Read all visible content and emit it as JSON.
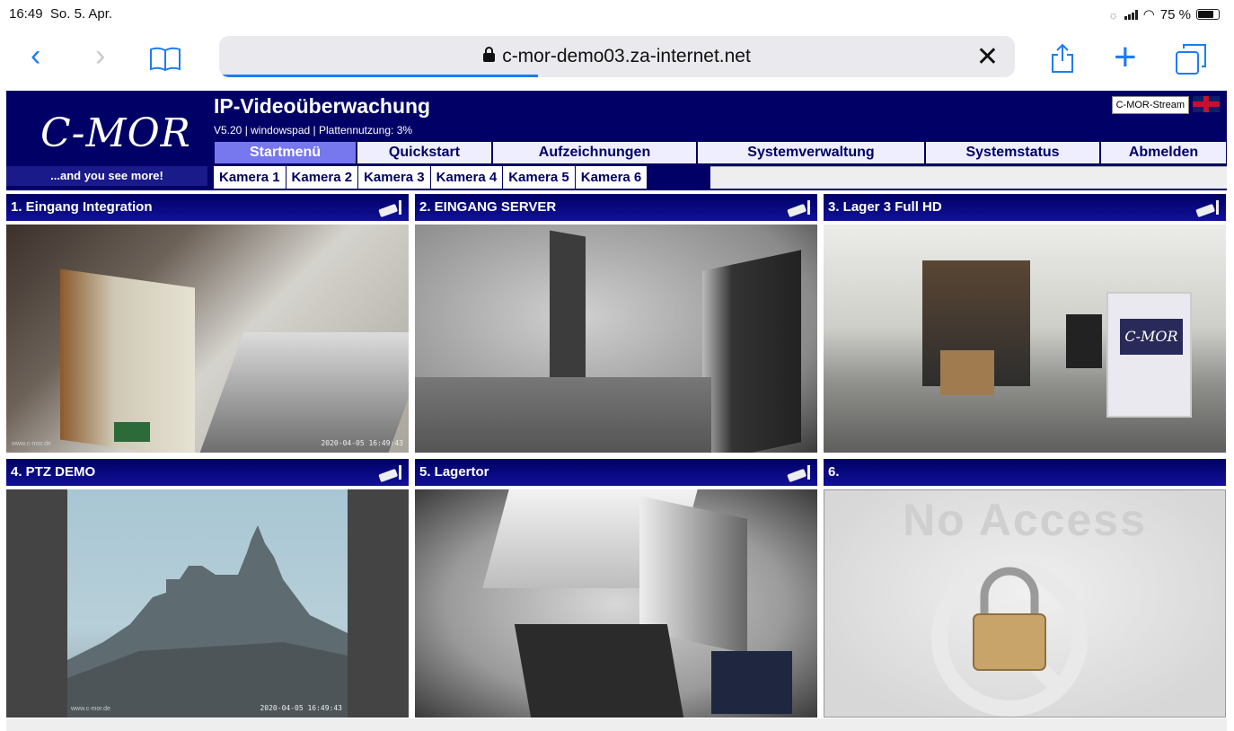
{
  "status_bar": {
    "time": "16:49",
    "date": "So. 5. Apr.",
    "battery": "75 %",
    "battery_level": 0.75
  },
  "browser": {
    "url": "c-mor-demo03.za-internet.net",
    "icons": [
      "back-icon",
      "forward-icon",
      "bookmarks-icon",
      "lock-icon",
      "clear-icon",
      "share-icon",
      "new-tab-icon",
      "tabs-icon"
    ],
    "accent": "#1c7cf4",
    "load_progress": 0.4
  },
  "app": {
    "logo": "C-MOR",
    "slogan": "...and you see more!",
    "title": "IP-Videoüberwachung",
    "subtitle": "V5.20 | windowspad | Plattennutzung: 3%",
    "stream_button": "C-MOR-Stream",
    "colors": {
      "header_bg": "#000066",
      "active_tab": "#7777ee"
    },
    "menu": [
      {
        "label": "Startmenü",
        "active": true
      },
      {
        "label": "Quickstart",
        "active": false
      },
      {
        "label": "Aufzeichnungen",
        "active": false
      },
      {
        "label": "Systemverwaltung",
        "active": false
      },
      {
        "label": "Systemstatus",
        "active": false
      },
      {
        "label": "Abmelden",
        "active": false
      }
    ],
    "cameras": [
      "Kamera 1",
      "Kamera 2",
      "Kamera 3",
      "Kamera 4",
      "Kamera 5",
      "Kamera 6"
    ]
  },
  "tiles": [
    {
      "title": "1. Eingang Integration",
      "stamp": "2020-04-05 16:49:43",
      "watermark": "www.c-mor.de"
    },
    {
      "title": "2. EINGANG SERVER",
      "stamp": "",
      "watermark": ""
    },
    {
      "title": "3. Lager 3 Full HD",
      "stamp": "",
      "watermark": ""
    },
    {
      "title": "4. PTZ DEMO",
      "stamp": "2020-04-05 16:49:43",
      "watermark": "www.c-mor.de"
    },
    {
      "title": "5. Lagertor",
      "stamp": "",
      "watermark": ""
    },
    {
      "title": "6.",
      "no_access": "No Access"
    }
  ]
}
